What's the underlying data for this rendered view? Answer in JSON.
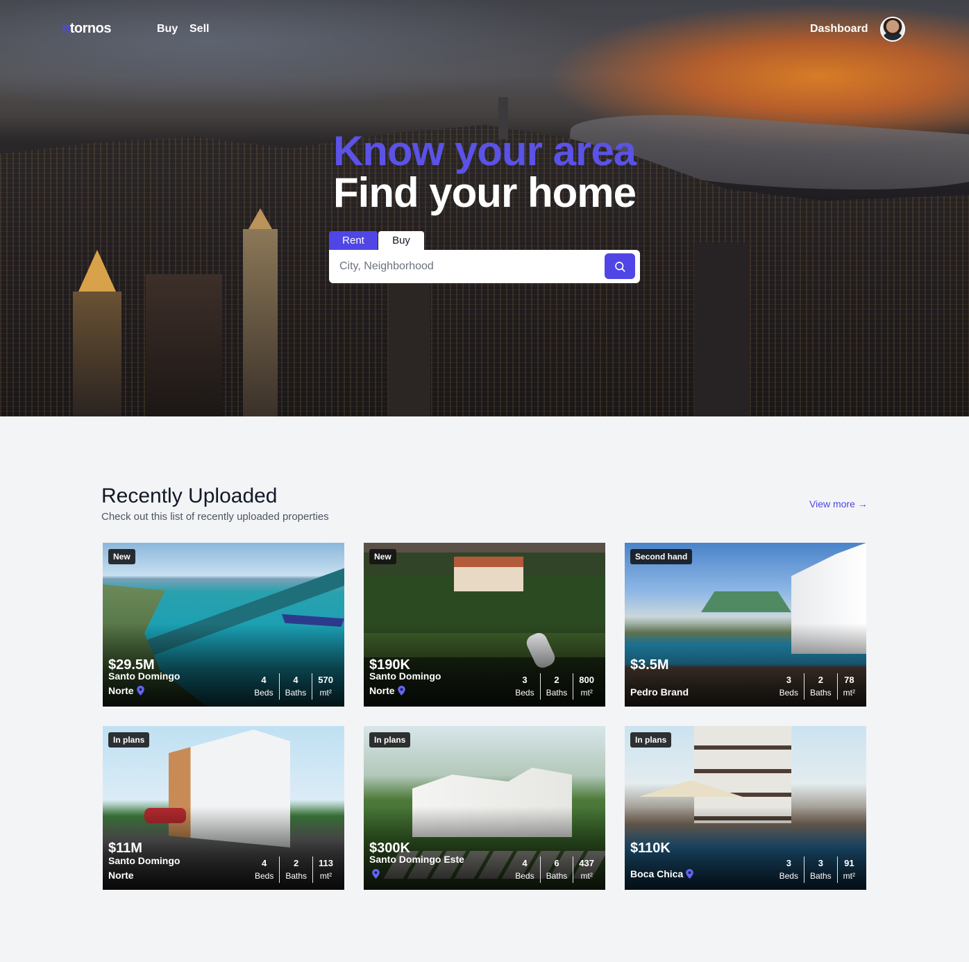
{
  "nav": {
    "logo_first": "n",
    "logo_rest": "tornos",
    "links": [
      "Buy",
      "Sell"
    ],
    "dashboard": "Dashboard",
    "avatar_icon": "user-avatar"
  },
  "hero": {
    "title_line1": "Know your area",
    "title_line2": "Find your home",
    "tabs": [
      "Rent",
      "Buy"
    ],
    "active_tab": "Rent",
    "search": {
      "placeholder": "City, Neighborhood",
      "value": "",
      "button_icon": "search-icon"
    }
  },
  "colors": {
    "accent": "#4f46e5",
    "page_bg": "#f3f4f6"
  },
  "section": {
    "title": "Recently Uploaded",
    "subtitle": "Check out this list of recently uploaded properties",
    "view_more": "View more →"
  },
  "stat_labels": {
    "beds": "Beds",
    "baths": "Baths",
    "area": "mt²"
  },
  "listings": [
    {
      "badge": "New",
      "price": "$29.5M",
      "location": "Santo Domingo Norte",
      "pin": true,
      "beds": "4",
      "baths": "4",
      "area": "570"
    },
    {
      "badge": "New",
      "price": "$190K",
      "location": "Santo Domingo Norte",
      "pin": true,
      "beds": "3",
      "baths": "2",
      "area": "800"
    },
    {
      "badge": "Second hand",
      "price": "$3.5M",
      "location": "Pedro Brand",
      "pin": false,
      "beds": "3",
      "baths": "2",
      "area": "78"
    },
    {
      "badge": "In plans",
      "price": "$11M",
      "location": "Santo Domingo Norte",
      "pin": false,
      "beds": "4",
      "baths": "2",
      "area": "113"
    },
    {
      "badge": "In plans",
      "price": "$300K",
      "location": "Santo Domingo Este",
      "pin": true,
      "beds": "4",
      "baths": "6",
      "area": "437"
    },
    {
      "badge": "In plans",
      "price": "$110K",
      "location": "Boca Chica",
      "pin": true,
      "beds": "3",
      "baths": "3",
      "area": "91"
    }
  ]
}
